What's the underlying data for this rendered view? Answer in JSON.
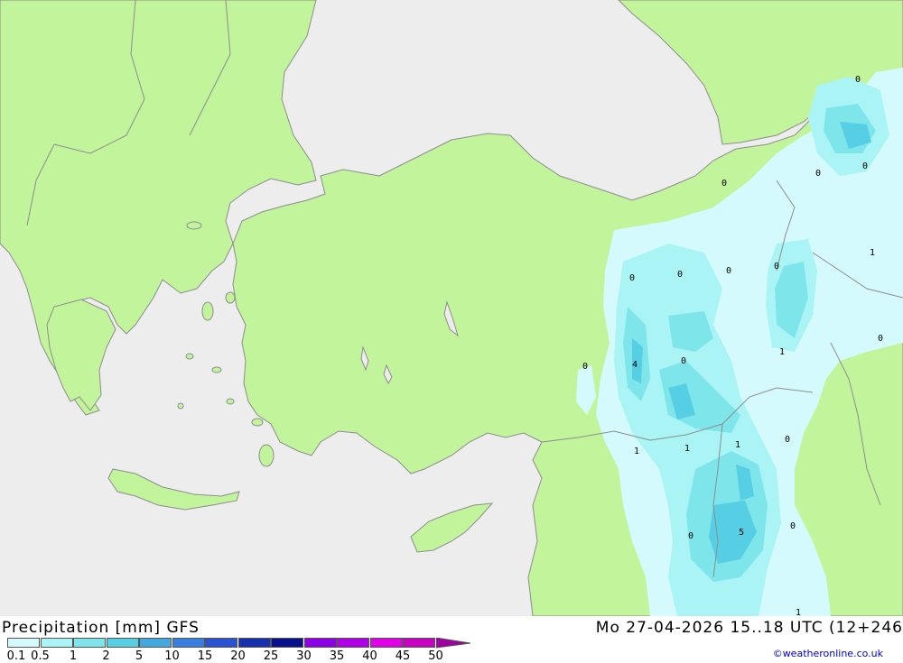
{
  "map": {
    "colors": {
      "sea": "#ededed",
      "land": "#c2f59b",
      "border": "#8d8d8d"
    },
    "cell_labels": [
      "0",
      "0",
      "0",
      "1",
      "0",
      "0",
      "0",
      "0",
      "0",
      "0",
      "0",
      "4",
      "0",
      "1",
      "0",
      "1",
      "1",
      "1",
      "0",
      "0",
      "5",
      "0",
      "1"
    ]
  },
  "footer": {
    "title": "Precipitation [mm] GFS",
    "datetime": "Mo 27-04-2026 15..18 UTC (12+246",
    "credit": "©weatheronline.co.uk"
  },
  "legend": {
    "ticks": [
      "0.1",
      "0.5",
      "1",
      "2",
      "5",
      "10",
      "15",
      "20",
      "25",
      "30",
      "35",
      "40",
      "45",
      "50"
    ],
    "colors": [
      "#d5fafd",
      "#aaf4f5",
      "#7ee5eb",
      "#56cfe4",
      "#42a8dd",
      "#3a7de0",
      "#2b52d1",
      "#1730b0",
      "#0a108c",
      "#8d00e6",
      "#b000e6",
      "#e000e6",
      "#c800c0",
      "#a000a0"
    ]
  }
}
